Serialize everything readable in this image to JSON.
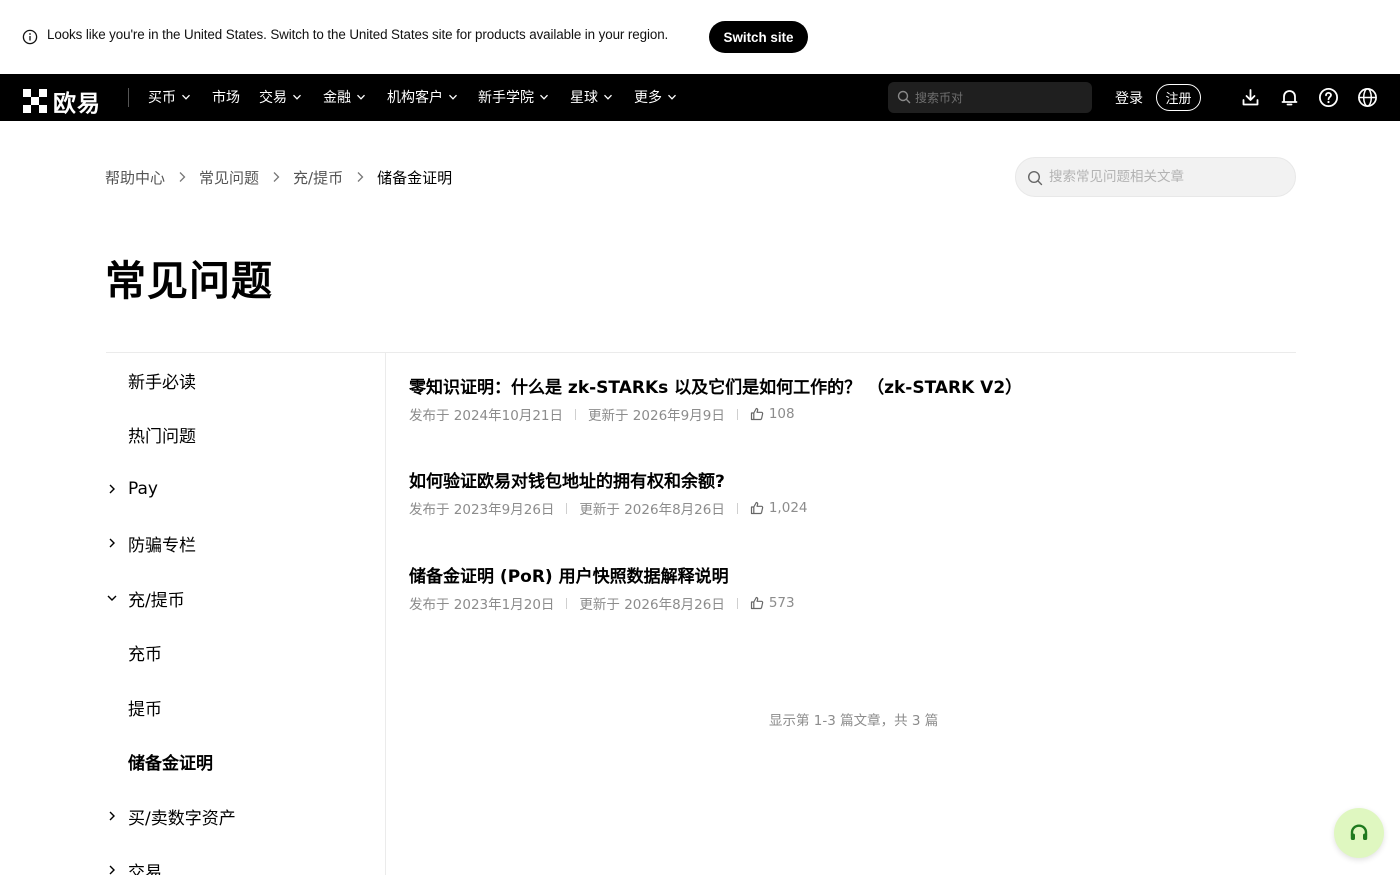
{
  "banner": {
    "text": "Looks like you're in the United States. Switch to the United States site for products available in your region.",
    "switch_label": "Switch site"
  },
  "nav": {
    "logo_text": "欧易",
    "items": [
      {
        "label": "买币",
        "has_menu": true
      },
      {
        "label": "市场",
        "has_menu": false
      },
      {
        "label": "交易",
        "has_menu": true
      },
      {
        "label": "金融",
        "has_menu": true
      },
      {
        "label": "机构客户",
        "has_menu": true
      },
      {
        "label": "新手学院",
        "has_menu": true
      },
      {
        "label": "星球",
        "has_menu": true
      },
      {
        "label": "更多",
        "has_menu": true
      }
    ],
    "search_placeholder": "搜索币对",
    "login_label": "登录",
    "register_label": "注册",
    "icons": [
      "download-icon",
      "bell-icon",
      "help-icon",
      "globe-icon"
    ]
  },
  "breadcrumb": [
    "帮助中心",
    "常见问题",
    "充/提币",
    "储备金证明"
  ],
  "help_search_placeholder": "搜索常见问题相关文章",
  "page_title": "常见问题",
  "sidebar": [
    {
      "label": "新手必读",
      "toggle": "none"
    },
    {
      "label": "热门问题",
      "toggle": "none"
    },
    {
      "label": "Pay",
      "toggle": "collapsed"
    },
    {
      "label": "防骗专栏",
      "toggle": "collapsed"
    },
    {
      "label": "充/提币",
      "toggle": "expanded"
    },
    {
      "label": "充币",
      "toggle": "none"
    },
    {
      "label": "提币",
      "toggle": "none"
    },
    {
      "label": "储备金证明",
      "toggle": "none",
      "active": true
    },
    {
      "label": "买/卖数字资产",
      "toggle": "collapsed"
    },
    {
      "label": "交易",
      "toggle": "collapsed"
    }
  ],
  "articles": [
    {
      "title": "零知识证明：什么是 zk-STARKs 以及它们是如何工作的？ （zk-STARK V2）",
      "published": "发布于 2024年10月21日",
      "updated": "更新于 2026年9月9日",
      "likes": "108"
    },
    {
      "title": "如何验证欧易对钱包地址的拥有权和余额?",
      "published": "发布于 2023年9月26日",
      "updated": "更新于 2026年8月26日",
      "likes": "1,024"
    },
    {
      "title": "储备金证明 (PoR) 用户快照数据解释说明",
      "published": "发布于 2023年1月20日",
      "updated": "更新于 2026年8月26日",
      "likes": "573"
    }
  ],
  "pager_summary": "显示第 1-3 篇文章，共 3 篇",
  "colors": {
    "nav_bg": "#000000",
    "support_bg": "#dff7c0",
    "muted_text": "#8c8c8c"
  }
}
